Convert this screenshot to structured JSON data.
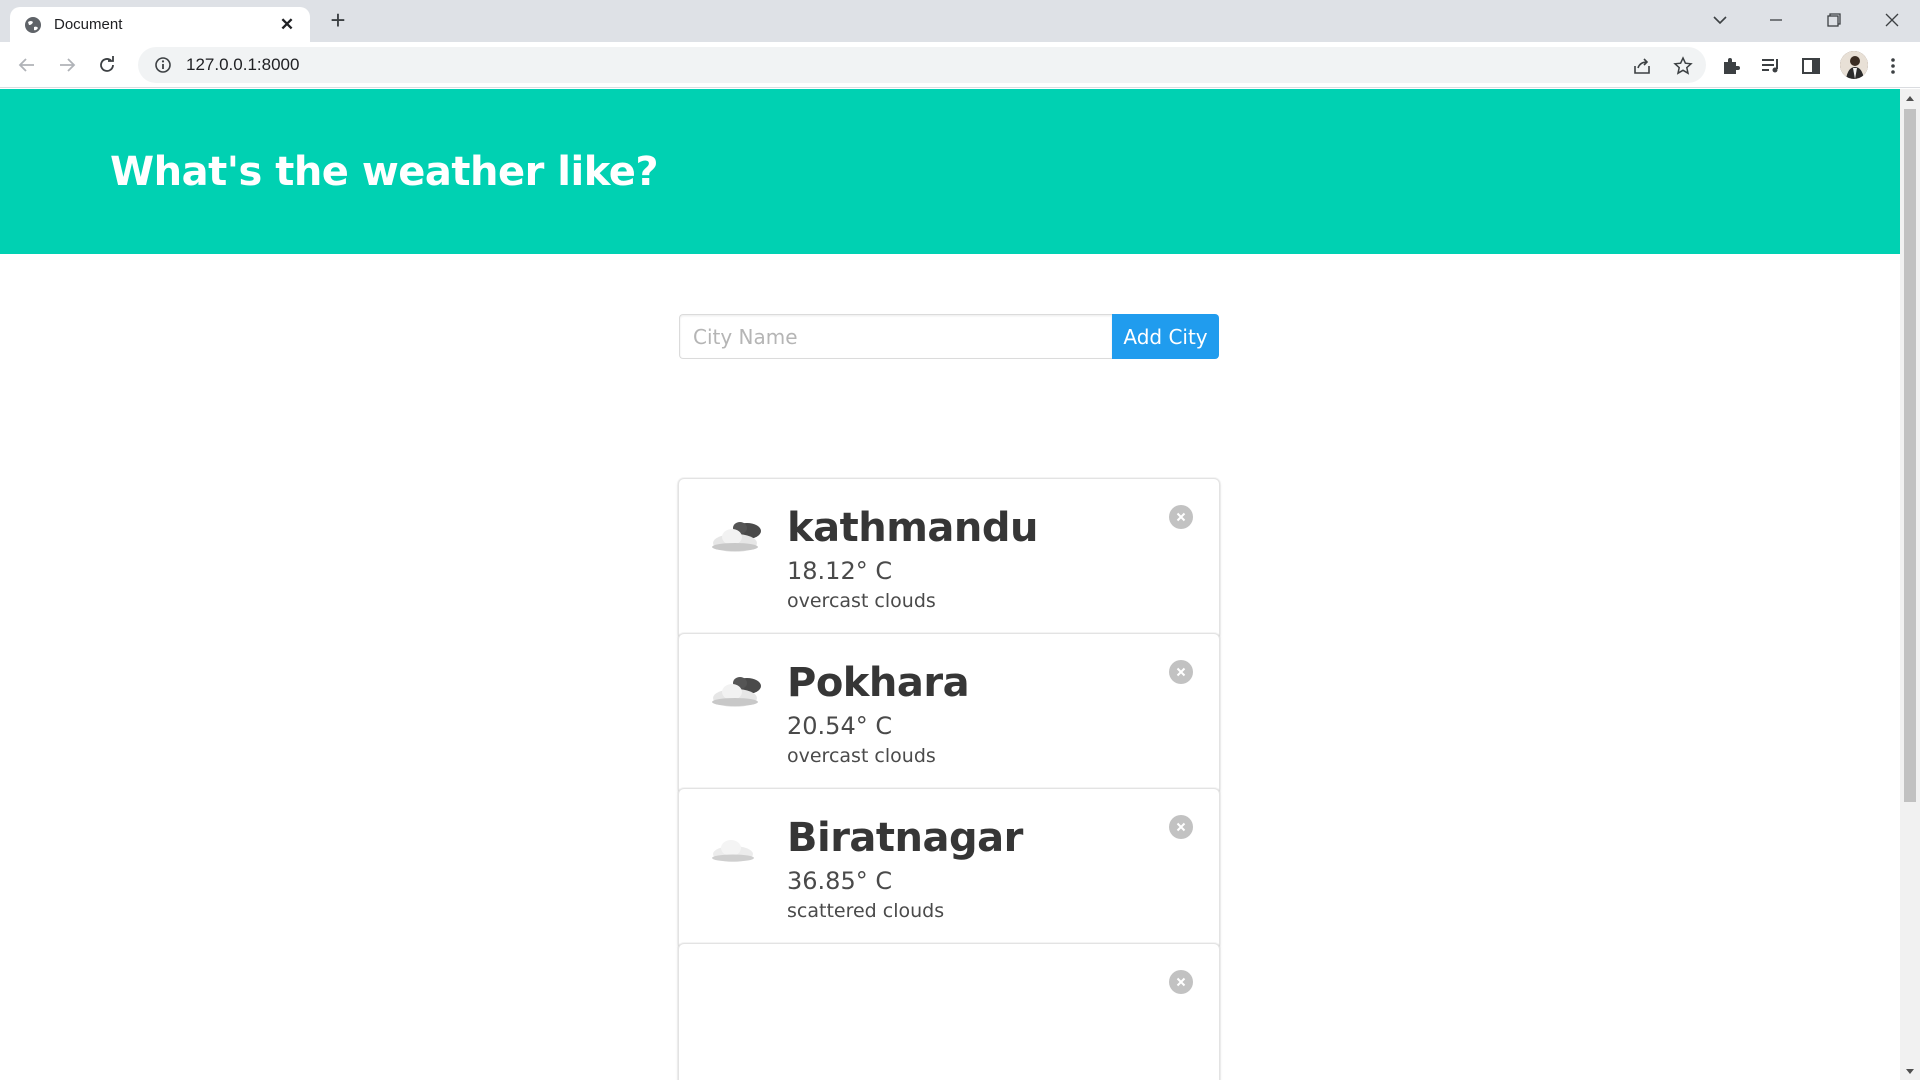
{
  "browser": {
    "tab_title": "Document",
    "tab_close": "✕",
    "new_tab": "+",
    "url": "127.0.0.1:8000"
  },
  "page": {
    "hero_title": "What's the weather like?",
    "input_placeholder": "City Name",
    "input_value": "",
    "add_button_label": "Add City",
    "accent_color": "#00d1b2",
    "button_color": "#209cee"
  },
  "cities": [
    {
      "name": "kathmandu",
      "temp": "18.12° C",
      "description": "overcast clouds",
      "icon": "broken-clouds-icon"
    },
    {
      "name": "Pokhara",
      "temp": "20.54° C",
      "description": "overcast clouds",
      "icon": "broken-clouds-icon"
    },
    {
      "name": "Biratnagar",
      "temp": "36.85° C",
      "description": "scattered clouds",
      "icon": "scattered-clouds-icon"
    }
  ]
}
